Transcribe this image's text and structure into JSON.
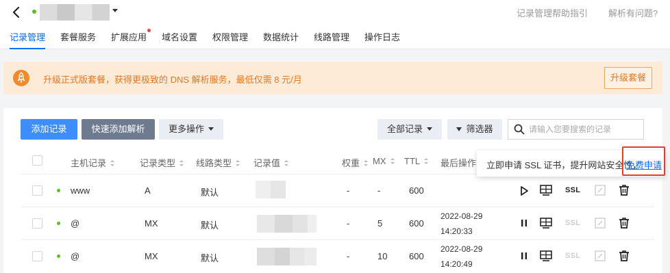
{
  "header": {
    "help_link": "记录管理帮助指引",
    "issue_link": "解析有问题?"
  },
  "tabs": [
    {
      "label": "记录管理",
      "active": true
    },
    {
      "label": "套餐服务"
    },
    {
      "label": "扩展应用",
      "badge_dot": true
    },
    {
      "label": "域名设置"
    },
    {
      "label": "权限管理"
    },
    {
      "label": "数据统计"
    },
    {
      "label": "线路管理"
    },
    {
      "label": "操作日志"
    }
  ],
  "banner": {
    "text": "升级正式版套餐，获得更极致的 DNS 解析服务，最低仅需 8 元/月",
    "button": "升级套餐"
  },
  "toolbar": {
    "add": "添加记录",
    "quick_add": "快速添加解析",
    "more": "更多操作",
    "filter_all": "全部记录",
    "filter": "筛选器",
    "search_placeholder": "请输入您要搜索的记录"
  },
  "table": {
    "headers": {
      "host": "主机记录",
      "type": "记录类型",
      "line": "线路类型",
      "value": "记录值",
      "weight": "权重",
      "mx": "MX",
      "ttl": "TTL",
      "last_op": "最后操作时"
    },
    "rows": [
      {
        "host": "www",
        "type": "A",
        "line": "默认",
        "weight": "-",
        "mx": "-",
        "ttl": "600",
        "date": "",
        "time": "",
        "ssl": "SSL"
      },
      {
        "host": "@",
        "type": "MX",
        "line": "默认",
        "weight": "-",
        "mx": "5",
        "ttl": "600",
        "date": "2022-08-29",
        "time": "14:20:33",
        "ssl": "SSL"
      },
      {
        "host": "@",
        "type": "MX",
        "line": "默认",
        "weight": "-",
        "mx": "10",
        "ttl": "600",
        "date": "2022-08-29",
        "time": "14:20:49",
        "ssl": "SSL"
      }
    ]
  },
  "tooltip": {
    "text": "立即申请 SSL 证书，提升网站安全性，",
    "link": "免费申请"
  },
  "colors": {
    "primary": "#006eff",
    "status_green": "#52c41a",
    "banner_text": "#e8761f",
    "highlight_red": "#e53a2d"
  }
}
